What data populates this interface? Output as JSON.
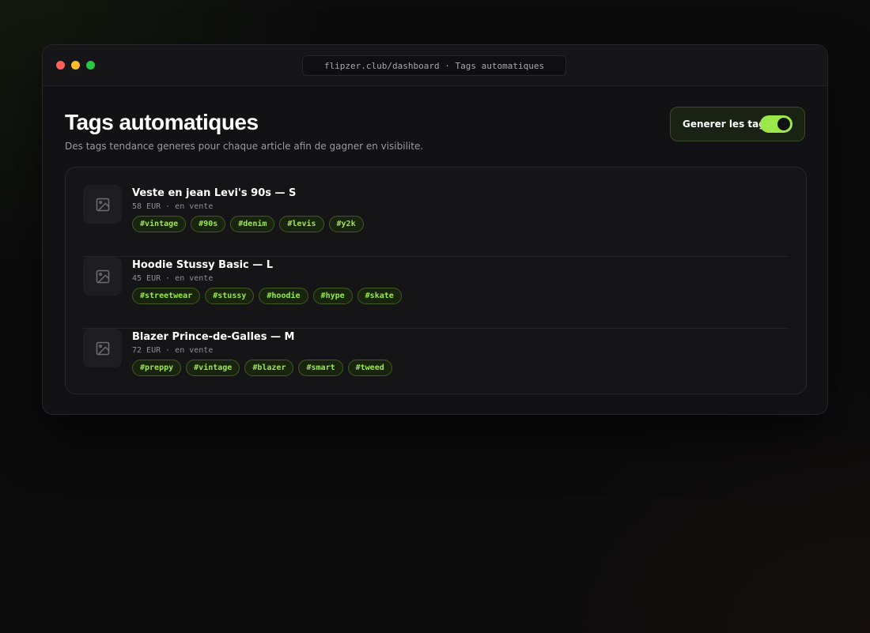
{
  "browser": {
    "url": "flipzer.club/dashboard · Tags automatiques"
  },
  "header": {
    "title": "Tags automatiques",
    "subtitle": "Des tags tendance generes pour chaque article afin de gagner en visibilite."
  },
  "toggle": {
    "label": "Generer les tags",
    "state": "on"
  },
  "items": [
    {
      "title": "Veste en jean Levi's 90s — S",
      "meta": "58 EUR · en vente",
      "tags": [
        "#vintage",
        "#90s",
        "#denim",
        "#levis",
        "#y2k"
      ]
    },
    {
      "title": "Hoodie Stussy Basic — L",
      "meta": "45 EUR · en vente",
      "tags": [
        "#streetwear",
        "#stussy",
        "#hoodie",
        "#hype",
        "#skate"
      ]
    },
    {
      "title": "Blazer Prince-de-Galles — M",
      "meta": "72 EUR · en vente",
      "tags": [
        "#preppy",
        "#vintage",
        "#blazer",
        "#smart",
        "#tweed"
      ]
    }
  ],
  "colors": {
    "accent": "#9be84a",
    "background": "#0b0b0c",
    "window": "#121214"
  }
}
